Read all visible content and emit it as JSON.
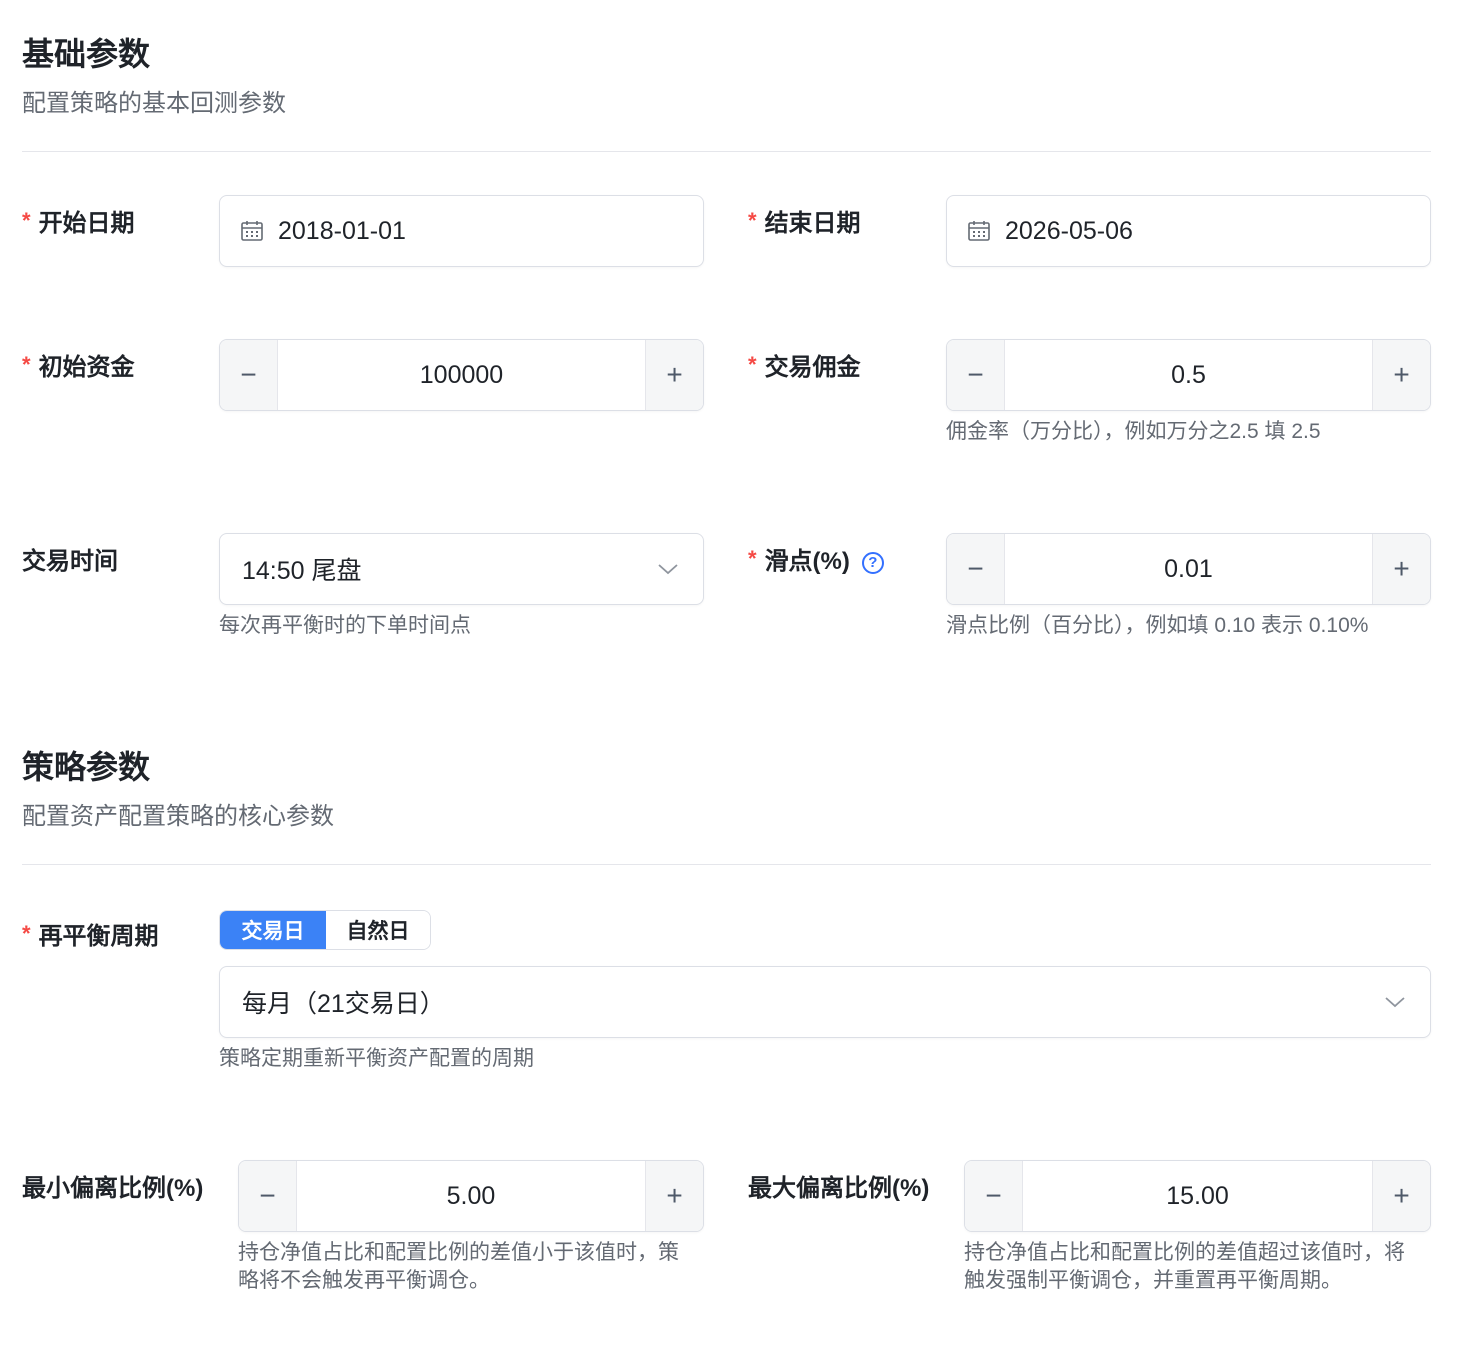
{
  "basic": {
    "title": "基础参数",
    "desc": "配置策略的基本回测参数",
    "start_date": {
      "label": "开始日期",
      "value": "2018-01-01",
      "icon": "calendar-icon"
    },
    "end_date": {
      "label": "结束日期",
      "value": "2026-05-06",
      "icon": "calendar-icon"
    },
    "initial_capital": {
      "label": "初始资金",
      "value": "100000",
      "minus": "−",
      "plus": "+"
    },
    "commission": {
      "label": "交易佣金",
      "value": "0.5",
      "minus": "−",
      "plus": "+",
      "hint": "佣金率（万分比），例如万分之2.5 填 2.5"
    },
    "trade_time": {
      "label": "交易时间",
      "value": "14:50 尾盘",
      "hint": "每次再平衡时的下单时间点"
    },
    "slippage": {
      "label": "滑点(%)",
      "help": "?",
      "value": "0.01",
      "minus": "−",
      "plus": "+",
      "hint": "滑点比例（百分比），例如填 0.10 表示 0.10%"
    }
  },
  "strategy": {
    "title": "策略参数",
    "desc": "配置资产配置策略的核心参数",
    "rebalance": {
      "label": "再平衡周期",
      "segment": [
        "交易日",
        "自然日"
      ],
      "selected_segment": "交易日",
      "value": "每月（21交易日）",
      "hint": "策略定期重新平衡资产配置的周期"
    },
    "min_deviation": {
      "label": "最小偏离比例(%)",
      "value": "5.00",
      "minus": "−",
      "plus": "+",
      "hint_line1": "持仓净值占比和配置比例的差值小于该值时，策",
      "hint_line2": "略将不会触发再平衡调仓。"
    },
    "max_deviation": {
      "label": "最大偏离比例(%)",
      "value": "15.00",
      "minus": "−",
      "plus": "+",
      "hint_line1": "持仓净值占比和配置比例的差值超过该值时，将",
      "hint_line2": "触发强制平衡调仓，并重置再平衡周期。"
    }
  },
  "required_mark": "*",
  "colors": {
    "accent": "#3b82f6",
    "required": "#f54a45",
    "help": "#3370ff"
  }
}
